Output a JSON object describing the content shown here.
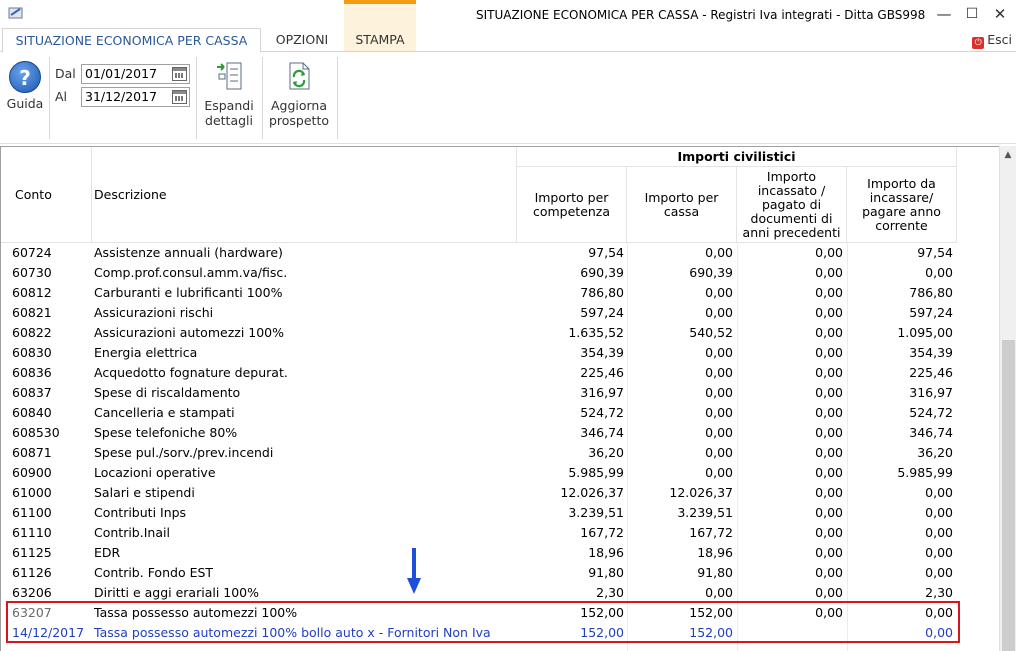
{
  "window": {
    "title": "SITUAZIONE ECONOMICA PER CASSA - Registri Iva integrati - Ditta GBS998",
    "minimize": "—",
    "maximize": "☐",
    "close": "✕"
  },
  "tabs": [
    {
      "label": "SITUAZIONE ECONOMICA PER CASSA"
    },
    {
      "label": "OPZIONI"
    },
    {
      "label": "STAMPA"
    }
  ],
  "esci": {
    "label": "Esci"
  },
  "ribbon": {
    "guida_label": "Guida",
    "dal_label": "Dal",
    "dal_value": "01/01/2017",
    "al_label": "Al",
    "al_value": "31/12/2017",
    "espandi_line1": "Espandi",
    "espandi_line2": "dettagli",
    "aggiorna_line1": "Aggiorna",
    "aggiorna_line2": "prospetto"
  },
  "grid": {
    "col_conto": "Conto",
    "col_descrizione": "Descrizione",
    "group_title": "Importi civilistici",
    "col_competenza": "Importo per competenza",
    "col_cassa": "Importo per cassa",
    "col_precedenti": "Importo incassato / pagato di documenti di anni precedenti",
    "col_corrente": "Importo da incassare/ pagare anno corrente",
    "rows": [
      {
        "conto": "60724",
        "descrizione": "Assistenze annuali (hardware)",
        "competenza": "97,54",
        "cassa": "0,00",
        "precedenti": "0,00",
        "corrente": "97,54"
      },
      {
        "conto": "60730",
        "descrizione": "Comp.prof.consul.amm.va/fisc.",
        "competenza": "690,39",
        "cassa": "690,39",
        "precedenti": "0,00",
        "corrente": "0,00"
      },
      {
        "conto": "60812",
        "descrizione": "Carburanti e lubrificanti 100%",
        "competenza": "786,80",
        "cassa": "0,00",
        "precedenti": "0,00",
        "corrente": "786,80"
      },
      {
        "conto": "60821",
        "descrizione": "Assicurazioni rischi",
        "competenza": "597,24",
        "cassa": "0,00",
        "precedenti": "0,00",
        "corrente": "597,24"
      },
      {
        "conto": "60822",
        "descrizione": "Assicurazioni automezzi 100%",
        "competenza": "1.635,52",
        "cassa": "540,52",
        "precedenti": "0,00",
        "corrente": "1.095,00"
      },
      {
        "conto": "60830",
        "descrizione": "Energia elettrica",
        "competenza": "354,39",
        "cassa": "0,00",
        "precedenti": "0,00",
        "corrente": "354,39"
      },
      {
        "conto": "60836",
        "descrizione": "Acquedotto fognature depurat.",
        "competenza": "225,46",
        "cassa": "0,00",
        "precedenti": "0,00",
        "corrente": "225,46"
      },
      {
        "conto": "60837",
        "descrizione": "Spese di riscaldamento",
        "competenza": "316,97",
        "cassa": "0,00",
        "precedenti": "0,00",
        "corrente": "316,97"
      },
      {
        "conto": "60840",
        "descrizione": "Cancelleria e stampati",
        "competenza": "524,72",
        "cassa": "0,00",
        "precedenti": "0,00",
        "corrente": "524,72"
      },
      {
        "conto": "608530",
        "descrizione": "Spese telefoniche 80%",
        "competenza": "346,74",
        "cassa": "0,00",
        "precedenti": "0,00",
        "corrente": "346,74"
      },
      {
        "conto": "60871",
        "descrizione": "Spese pul./sorv./prev.incendi",
        "competenza": "36,20",
        "cassa": "0,00",
        "precedenti": "0,00",
        "corrente": "36,20"
      },
      {
        "conto": "60900",
        "descrizione": "Locazioni operative",
        "competenza": "5.985,99",
        "cassa": "0,00",
        "precedenti": "0,00",
        "corrente": "5.985,99"
      },
      {
        "conto": "61000",
        "descrizione": "Salari e stipendi",
        "competenza": "12.026,37",
        "cassa": "12.026,37",
        "precedenti": "0,00",
        "corrente": "0,00"
      },
      {
        "conto": "61100",
        "descrizione": "Contributi Inps",
        "competenza": "3.239,51",
        "cassa": "3.239,51",
        "precedenti": "0,00",
        "corrente": "0,00"
      },
      {
        "conto": "61110",
        "descrizione": "Contrib.Inail",
        "competenza": "167,72",
        "cassa": "167,72",
        "precedenti": "0,00",
        "corrente": "0,00"
      },
      {
        "conto": "61125",
        "descrizione": "EDR",
        "competenza": "18,96",
        "cassa": "18,96",
        "precedenti": "0,00",
        "corrente": "0,00"
      },
      {
        "conto": "61126",
        "descrizione": "Contrib. Fondo EST",
        "competenza": "91,80",
        "cassa": "91,80",
        "precedenti": "0,00",
        "corrente": "0,00"
      },
      {
        "conto": "63206",
        "descrizione": "Diritti e aggi erariali 100%",
        "competenza": "2,30",
        "cassa": "0,00",
        "precedenti": "0,00",
        "corrente": "2,30"
      },
      {
        "conto": "63207",
        "descrizione": "Tassa possesso automezzi 100%",
        "competenza": "152,00",
        "cassa": "152,00",
        "precedenti": "0,00",
        "corrente": "0,00",
        "style": "muted"
      },
      {
        "conto": "14/12/2017",
        "descrizione": "Tassa possesso automezzi 100% bollo auto x -  Fornitori Non Iva",
        "competenza": "152,00",
        "cassa": "152,00",
        "precedenti": "",
        "corrente": "0,00",
        "style": "blue"
      }
    ]
  },
  "colors": {
    "accent_tab": "#f39c12",
    "highlight_box": "#d9141b",
    "arrow": "#1e4fd8",
    "detail_row_text": "#1f3fbf"
  }
}
